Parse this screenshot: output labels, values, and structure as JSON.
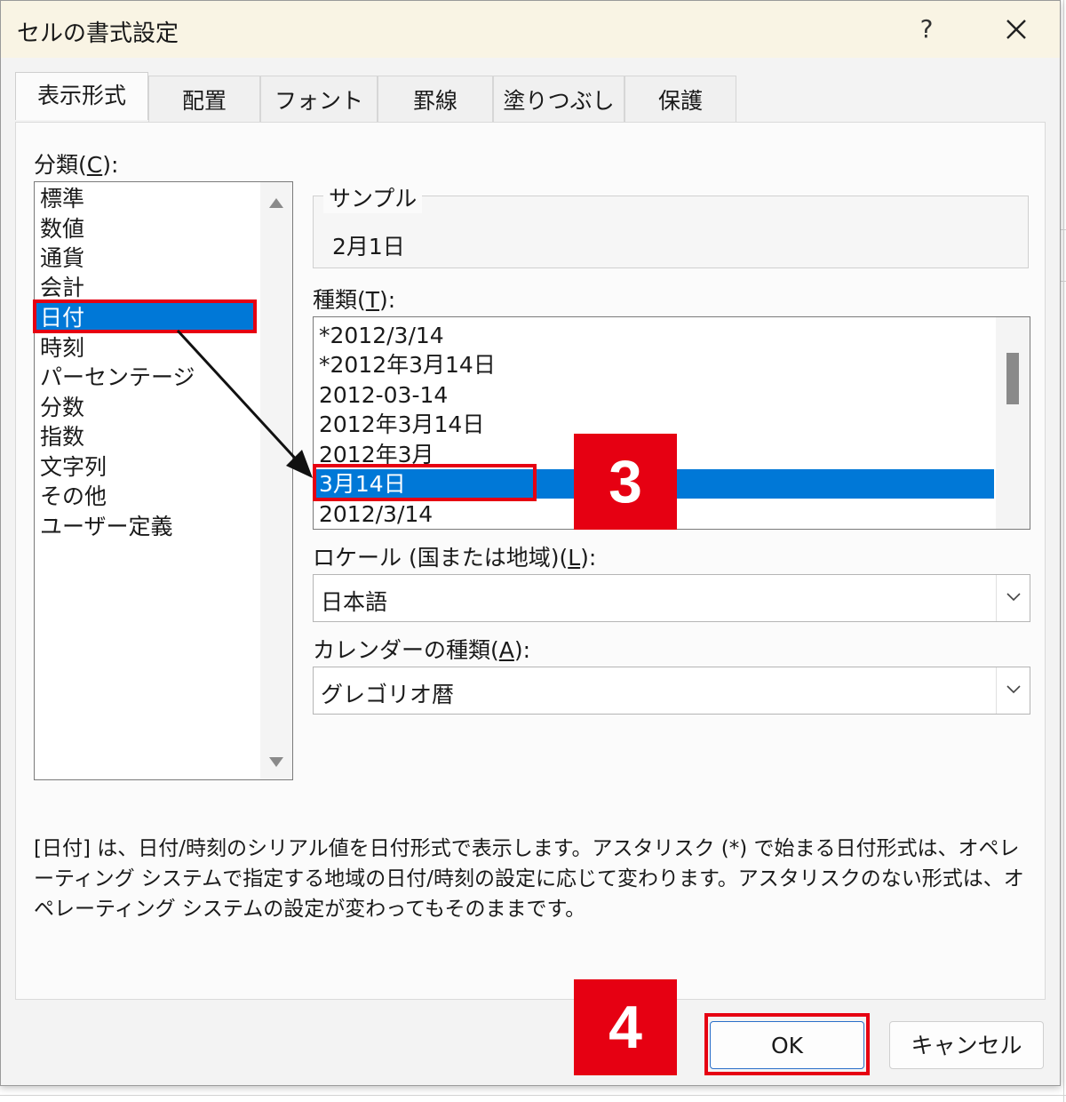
{
  "dialog": {
    "title": "セルの書式設定",
    "help_label": "?",
    "tabs": [
      {
        "label": "表示形式",
        "active": true
      },
      {
        "label": "配置"
      },
      {
        "label": "フォント"
      },
      {
        "label": "罫線"
      },
      {
        "label": "塗りつぶし"
      },
      {
        "label": "保護"
      }
    ]
  },
  "category": {
    "label_prefix": "分類(",
    "label_key": "C",
    "label_suffix": "):",
    "items": [
      "標準",
      "数値",
      "通貨",
      "会計",
      "日付",
      "時刻",
      "パーセンテージ",
      "分数",
      "指数",
      "文字列",
      "その他",
      "ユーザー定義"
    ],
    "selected_index": 4
  },
  "sample": {
    "legend": "サンプル",
    "value": "2月1日"
  },
  "type": {
    "label_prefix": "種類(",
    "label_key": "T",
    "label_suffix": "):",
    "items": [
      "*2012/3/14",
      "*2012年3月14日",
      "2012-03-14",
      "2012年3月14日",
      "2012年3月",
      "3月14日",
      "2012/3/14"
    ],
    "selected_index": 5
  },
  "locale": {
    "label_prefix": "ロケール (国または地域)(",
    "label_key": "L",
    "label_suffix": "):",
    "value": "日本語"
  },
  "calendar": {
    "label_prefix": "カレンダーの種類(",
    "label_key": "A",
    "label_suffix": "):",
    "value": "グレゴリオ暦"
  },
  "description": "[日付] は、日付/時刻のシリアル値を日付形式で表示します。アスタリスク (*) で始まる日付形式は、オペレーティング システムで指定する地域の日付/時刻の設定に応じて変わります。アスタリスクのない形式は、オペレーティング システムの設定が変わってもそのままです。",
  "buttons": {
    "ok": "OK",
    "cancel": "キャンセル"
  },
  "annotations": {
    "step3": "3",
    "step4": "4",
    "color": "#e60012"
  },
  "colors": {
    "selection": "#0078d7",
    "titlebar": "#f9f4e4"
  }
}
